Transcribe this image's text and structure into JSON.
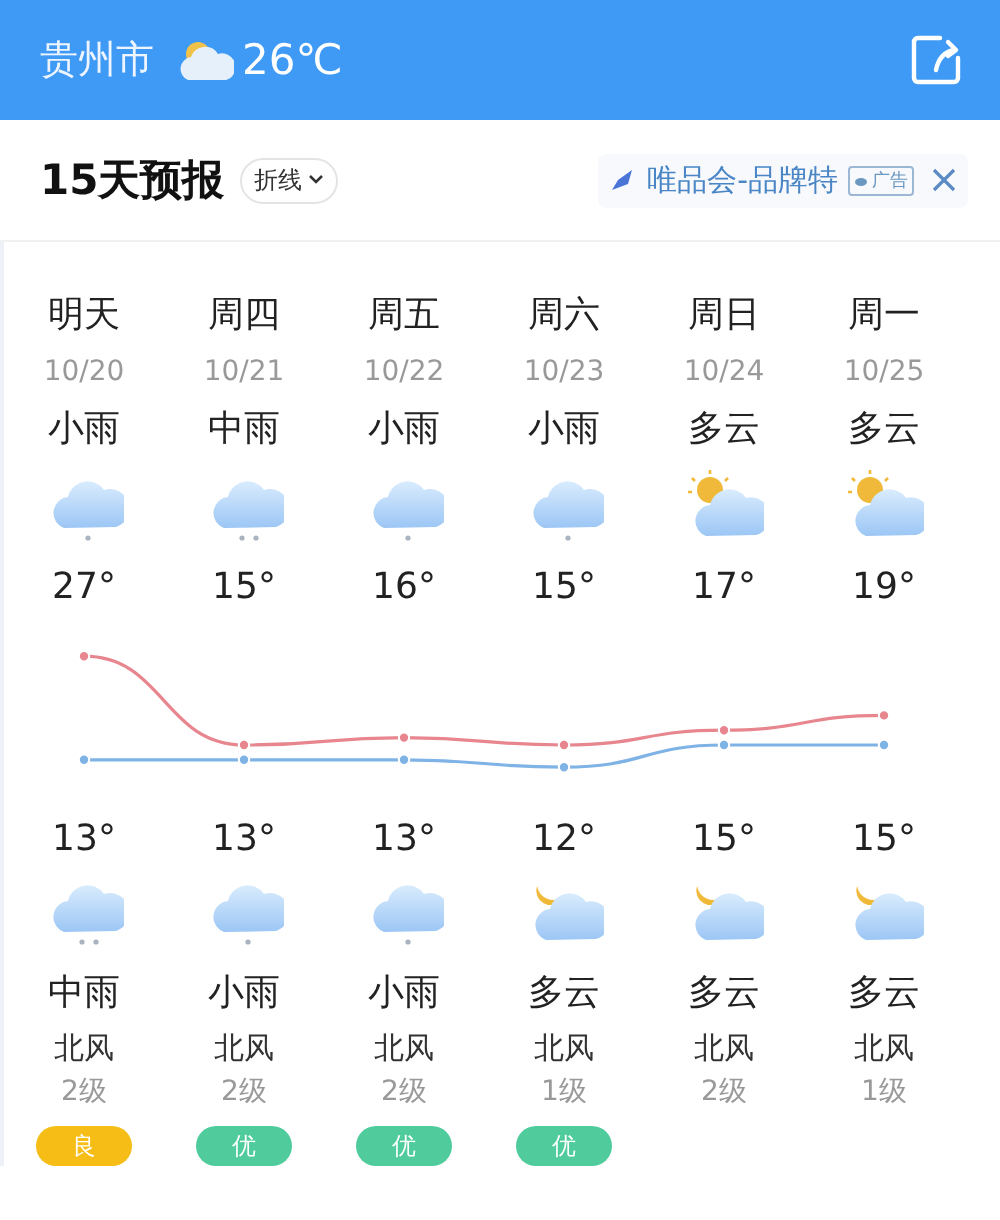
{
  "header": {
    "city": "贵州市",
    "temperature": "26℃"
  },
  "forecast": {
    "title": "15天预报",
    "view_toggle": "折线",
    "ad": {
      "text": "唯品会-品牌特",
      "tag": "广告"
    }
  },
  "days": [
    {
      "day": "明天",
      "date": "10/20",
      "daytime": {
        "weather": "小雨",
        "kind": "light-rain"
      },
      "night": {
        "kind": "moderate-rain",
        "weather": "中雨"
      },
      "wind": "北风",
      "wind_level": "2级",
      "air": {
        "label": "良",
        "color": "#f6bd16"
      }
    },
    {
      "day": "周四",
      "date": "10/21",
      "daytime": {
        "weather": "中雨",
        "kind": "moderate-rain"
      },
      "night": {
        "kind": "light-rain",
        "weather": "小雨"
      },
      "wind": "北风",
      "wind_level": "2级",
      "air": {
        "label": "优",
        "color": "#4fcb9c"
      }
    },
    {
      "day": "周五",
      "date": "10/22",
      "daytime": {
        "weather": "小雨",
        "kind": "light-rain"
      },
      "night": {
        "kind": "light-rain",
        "weather": "小雨"
      },
      "wind": "北风",
      "wind_level": "2级",
      "air": {
        "label": "优",
        "color": "#4fcb9c"
      }
    },
    {
      "day": "周六",
      "date": "10/23",
      "daytime": {
        "weather": "小雨",
        "kind": "light-rain"
      },
      "night": {
        "kind": "cloudy-night",
        "weather": "多云"
      },
      "wind": "北风",
      "wind_level": "1级",
      "air": {
        "label": "优",
        "color": "#4fcb9c"
      }
    },
    {
      "day": "周日",
      "date": "10/24",
      "daytime": {
        "weather": "多云",
        "kind": "cloudy-day"
      },
      "night": {
        "kind": "cloudy-night",
        "weather": "多云"
      },
      "wind": "北风",
      "wind_level": "2级"
    },
    {
      "day": "周一",
      "date": "10/25",
      "daytime": {
        "weather": "多云",
        "kind": "cloudy-day"
      },
      "night": {
        "kind": "cloudy-night",
        "weather": "多云"
      },
      "wind": "北风",
      "wind_level": "1级"
    }
  ],
  "chart_data": {
    "type": "line",
    "series": [
      {
        "color": "#e8868f",
        "marker": "circle",
        "values": [
          27,
          15,
          16,
          15,
          17,
          19
        ],
        "value_labels": [
          "27°",
          "15°",
          "16°",
          "15°",
          "17°",
          "19°"
        ]
      },
      {
        "color": "#7fb3e6",
        "marker": "circle",
        "values": [
          13,
          13,
          13,
          12,
          15,
          15
        ],
        "value_labels": [
          "13°",
          "13°",
          "13°",
          "12°",
          "15°",
          "15°"
        ]
      }
    ]
  }
}
